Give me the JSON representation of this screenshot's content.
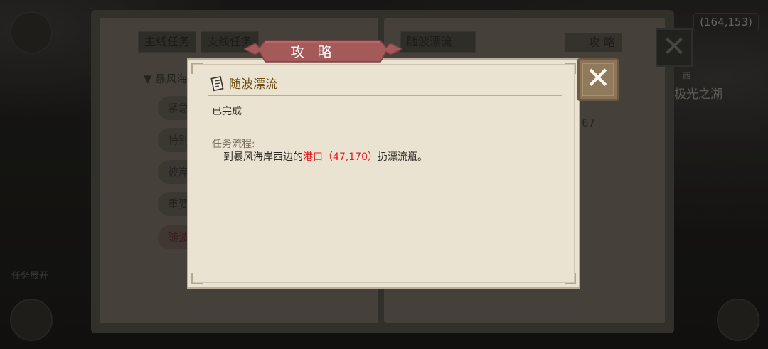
{
  "hud": {
    "coordinates": "(164,153)",
    "minimap_location": "极光之湖",
    "minimap_direction": "西",
    "task_toggle": "任务展开"
  },
  "book": {
    "tabs": [
      "主线任务",
      "支线任务"
    ],
    "tree_header": "暴风海",
    "tree_items": [
      "紧急",
      "特别",
      "彼岸",
      "重要",
      "随波"
    ],
    "right_tab": "随波漂流",
    "strategy_button": "攻 略",
    "right_number": "67"
  },
  "dialog": {
    "header": "攻 略",
    "quest_title": "随波漂流",
    "status": "已完成",
    "flow_label": "任务流程:",
    "flow_prefix": "到暴风海岸西边的",
    "flow_highlight": "港口（47,170）",
    "flow_suffix": "扔漂流瓶。"
  },
  "colors": {
    "dialog_bg": "#ebe3d2",
    "ribbon": "#a55a5a",
    "quest_title": "#6e4d14",
    "highlight": "#e11c1c",
    "close_button": "#8b7458"
  },
  "icons": {
    "close": "close-icon",
    "quest": "scroll-icon",
    "strategy": "scroll-icon"
  }
}
